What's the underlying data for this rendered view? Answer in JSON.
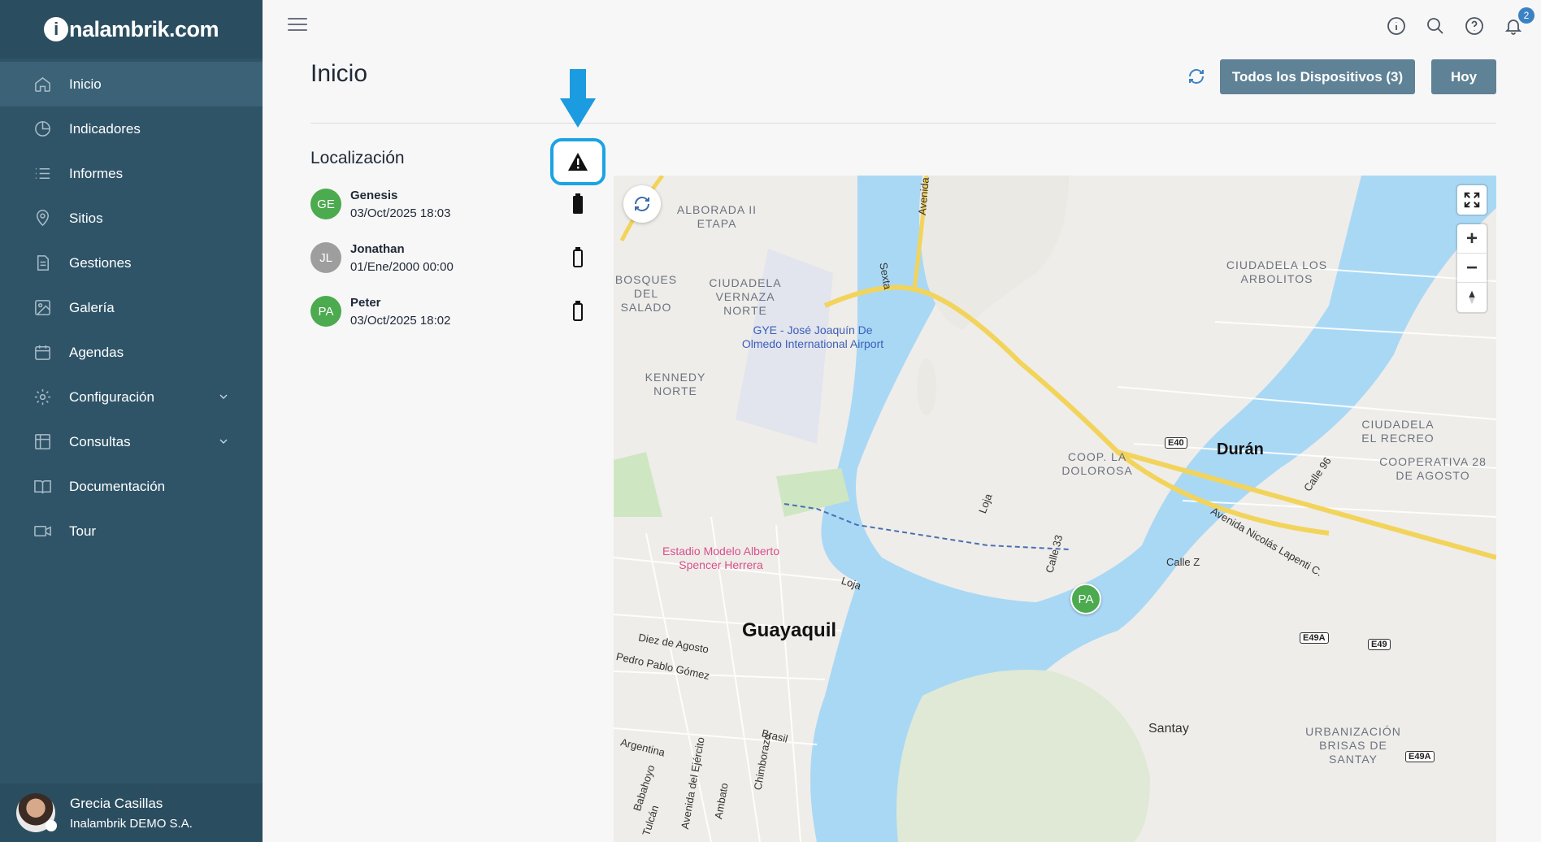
{
  "brand": {
    "logo_text": "nalambrik.com",
    "logo_initial": "i"
  },
  "sidebar": {
    "items": [
      {
        "label": "Inicio",
        "icon": "home-icon",
        "active": true
      },
      {
        "label": "Indicadores",
        "icon": "pie-chart-icon"
      },
      {
        "label": "Informes",
        "icon": "list-icon"
      },
      {
        "label": "Sitios",
        "icon": "map-pin-icon"
      },
      {
        "label": "Gestiones",
        "icon": "document-icon"
      },
      {
        "label": "Galería",
        "icon": "image-icon"
      },
      {
        "label": "Agendas",
        "icon": "calendar-icon"
      },
      {
        "label": "Configuración",
        "icon": "gear-icon",
        "expandable": true
      },
      {
        "label": "Consultas",
        "icon": "table-icon",
        "expandable": true
      },
      {
        "label": "Documentación",
        "icon": "book-icon"
      },
      {
        "label": "Tour",
        "icon": "video-icon"
      }
    ]
  },
  "user": {
    "name": "Grecia Casillas",
    "org": "Inalambrik DEMO S.A."
  },
  "topbar": {
    "notifications_count": "2",
    "icons": [
      "info-icon",
      "search-icon",
      "help-icon",
      "bell-icon"
    ]
  },
  "page": {
    "title": "Inicio",
    "devices_button": "Todos los Dispositivos (3)",
    "today_button": "Hoy"
  },
  "location": {
    "title": "Localización",
    "devices": [
      {
        "initials": "GE",
        "name": "Genesis",
        "time": "03/Oct/2025 18:03",
        "color": "#4caa4f",
        "battery": "full"
      },
      {
        "initials": "JL",
        "name": "Jonathan",
        "time": "01/Ene/2000 00:00",
        "color": "#9e9e9e",
        "battery": "empty"
      },
      {
        "initials": "PA",
        "name": "Peter",
        "time": "03/Oct/2025 18:02",
        "color": "#4caa4f",
        "battery": "empty"
      }
    ]
  },
  "map": {
    "labels": {
      "alborada": "ALBORADA II ETAPA",
      "bosques": "BOSQUES DEL SALADO",
      "ciudadela_vernaza": "CIUDADELA VERNAZA NORTE",
      "kennedy": "KENNEDY NORTE",
      "arbolitos": "CIUDADELA LOS ARBOLITOS",
      "recreo": "CIUDADELA EL RECREO",
      "cooperativa": "COOPERATIVA 28 DE AGOSTO",
      "dolorosa": "COOP. LA DOLOROSA",
      "brisas": "URBANIZACIÓN BRISAS DE SANTAY"
    },
    "airport": "GYE - José Joaquín De Olmedo International Airport",
    "stadium": "Estadio Modelo Alberto Spencer Herrera",
    "cities": {
      "guayaquil": "Guayaquil",
      "duran": "Durán",
      "santay": "Santay"
    },
    "roads": {
      "diez": "Diez de Agosto",
      "pedro": "Pedro Pablo Gómez",
      "argentina": "Argentina",
      "brasil": "Brasil",
      "loja": "Loja",
      "loja2": "Loja",
      "calle33": "Calle 33",
      "callez": "Calle Z",
      "calle96": "Calle 96",
      "nicolas": "Avenida Nicolás Lapenti C.",
      "sexta": "Sexta",
      "avenida": "Avenida",
      "babahoyo": "Babahoyo",
      "tulcan": "Tulcán",
      "ejercito": "Avenida del Ejército",
      "ambato": "Ambato",
      "chimborazo": "Chimborazo"
    },
    "shields": {
      "e40": "E40",
      "e49a": "E49A",
      "e49": "E49",
      "e49a2": "E49A"
    },
    "marker": "PA"
  }
}
